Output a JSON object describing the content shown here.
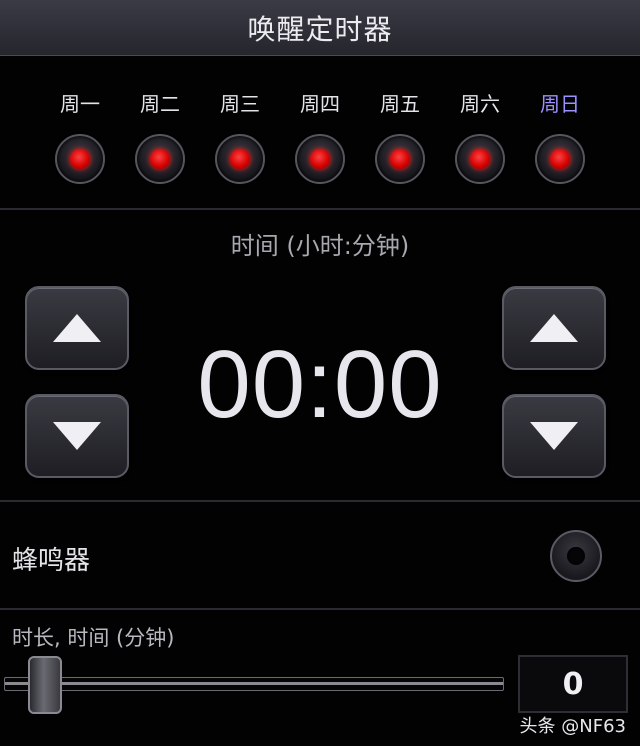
{
  "header": {
    "title": "唤醒定时器"
  },
  "days": [
    {
      "label": "周一",
      "active": true
    },
    {
      "label": "周二",
      "active": true
    },
    {
      "label": "周三",
      "active": true
    },
    {
      "label": "周四",
      "active": true
    },
    {
      "label": "周五",
      "active": true
    },
    {
      "label": "周六",
      "active": true
    },
    {
      "label": "周日",
      "active": true,
      "highlight": true
    }
  ],
  "time": {
    "title": "时间 (小时:分钟)",
    "display": "00:00",
    "hour_up_icon": "triangle-up",
    "hour_down_icon": "triangle-down",
    "minute_up_icon": "triangle-up",
    "minute_down_icon": "triangle-down"
  },
  "buzzer": {
    "label": "蜂鸣器",
    "enabled": false
  },
  "duration": {
    "label": "时长, 时间 (分钟)",
    "value": "0",
    "slider_fraction": 0
  },
  "watermark": "头条 @NF63",
  "colors": {
    "led_on": "#e00000",
    "sunday_label": "#9a90ff",
    "background": "#020203"
  }
}
